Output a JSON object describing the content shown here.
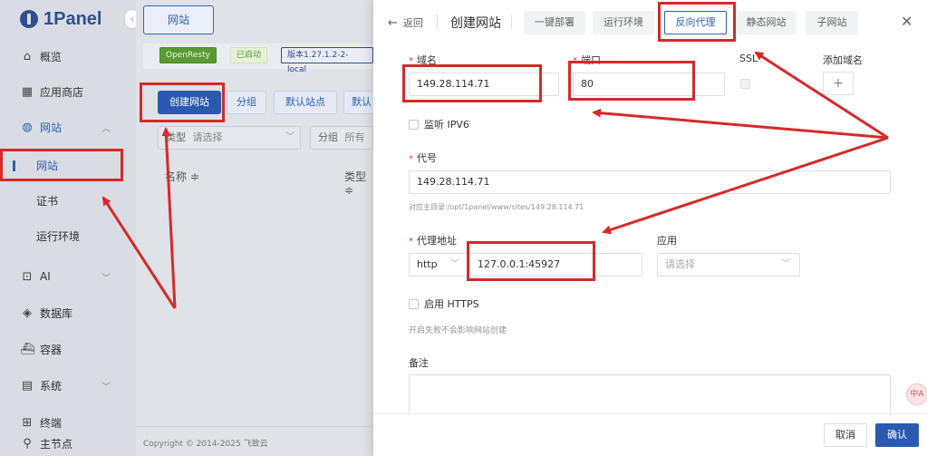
{
  "brand": {
    "name": "1Panel"
  },
  "sidebar": {
    "collapse_glyph": "‹",
    "items": [
      {
        "label": "概览",
        "icon": "home-icon"
      },
      {
        "label": "应用商店",
        "icon": "grid-icon"
      },
      {
        "label": "网站",
        "icon": "globe-icon"
      },
      {
        "label": "网站",
        "icon": ""
      },
      {
        "label": "证书",
        "icon": ""
      },
      {
        "label": "运行环境",
        "icon": ""
      },
      {
        "label": "AI",
        "icon": "robot-icon"
      },
      {
        "label": "数据库",
        "icon": "database-icon"
      },
      {
        "label": "容器",
        "icon": "container-icon"
      },
      {
        "label": "系统",
        "icon": "system-icon"
      },
      {
        "label": "终端",
        "icon": "terminal-icon"
      },
      {
        "label": "主节点",
        "icon": "user-icon"
      }
    ]
  },
  "main": {
    "tab_label": "网站",
    "status": {
      "openresty": "OpenResty",
      "running": "已启动",
      "version": "版本1.27.1.2-2-local"
    },
    "toolbar": {
      "create": "创建网站",
      "group": "分组",
      "default_site": "默认站点",
      "more": "默认"
    },
    "filters": {
      "type_label": "类型",
      "type_placeholder": "请选择",
      "group_label": "分组",
      "group_value": "所有"
    },
    "columns": {
      "name": "名称 ≑",
      "type": "类型 ≑"
    },
    "footer": "Copyright © 2014-2025 飞致云"
  },
  "drawer": {
    "back": "返回",
    "title": "创建网站",
    "tabs": [
      {
        "label": "一键部署",
        "active": false
      },
      {
        "label": "运行环境",
        "active": false
      },
      {
        "label": "反向代理",
        "active": true
      },
      {
        "label": "静态网站",
        "active": false
      },
      {
        "label": "子网站",
        "active": false
      }
    ],
    "form": {
      "domain_label": "域名",
      "domain_value": "149.28.114.71",
      "port_label": "端口",
      "port_value": "80",
      "ssl_label": "SSL",
      "add_domain_label": "添加域名",
      "add_glyph": "+",
      "ipv6_label": "监听 IPV6",
      "alias_label": "代号",
      "alias_value": "149.28.114.71",
      "alias_hint": "对应主目录:/opt/1panel/www/sites/149.28.114.71",
      "proxy_label": "代理地址",
      "proxy_scheme": "http",
      "proxy_value": "127.0.0.1:45927",
      "app_label": "应用",
      "app_placeholder": "请选择",
      "https_label": "启用 HTTPS",
      "https_hint": "开启失败不会影响网站创建",
      "remark_label": "备注"
    },
    "footer": {
      "cancel": "取消",
      "confirm": "确认"
    },
    "float_icon_text": "中A"
  },
  "colors": {
    "accent": "#2f5fb5",
    "annotation": "#d62a2a",
    "required": "#e0413a"
  }
}
